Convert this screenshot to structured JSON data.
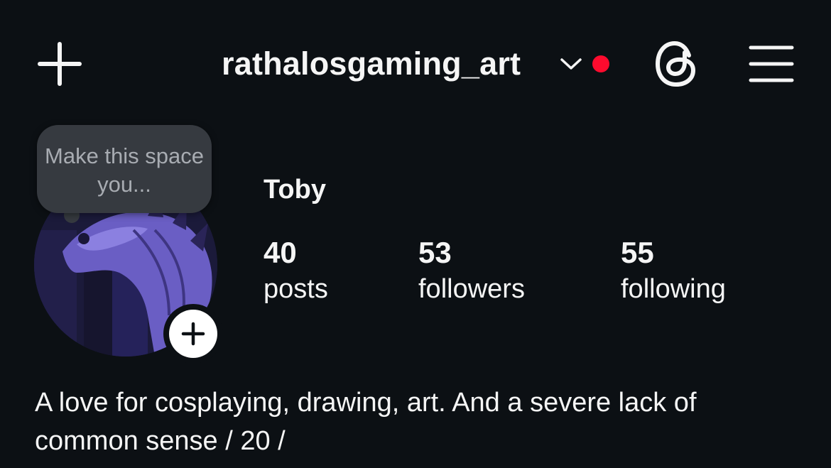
{
  "header": {
    "username": "rathalosgaming_art",
    "add_icon": "plus-icon",
    "dropdown_icon": "chevron-down-icon",
    "threads_icon": "threads-icon",
    "menu_icon": "hamburger-menu-icon",
    "notification_color": "#ff0b2e"
  },
  "profile": {
    "display_name": "Toby",
    "note_text": "Make this space you...",
    "avatar_description": "avatar"
  },
  "stats": {
    "posts": {
      "count": "40",
      "label": "posts"
    },
    "followers": {
      "count": "53",
      "label": "followers"
    },
    "following": {
      "count": "55",
      "label": "following"
    }
  },
  "bio": {
    "line1": "A love for cosplaying, drawing, art. And a severe lack of",
    "line2": "common sense / 20 /"
  },
  "colors": {
    "background": "#0c1014",
    "text": "#f5f5f5",
    "note_bg": "#363a40",
    "note_text": "#a8acb2"
  }
}
